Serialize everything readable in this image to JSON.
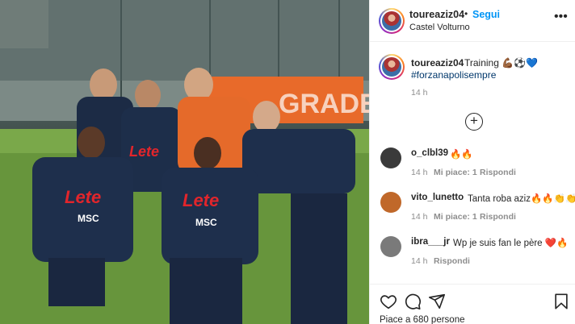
{
  "post": {
    "username": "toureaziz04",
    "separator": "•",
    "follow_label": "Segui",
    "location": "Castel Volturno",
    "more_label": "•••"
  },
  "caption": {
    "username": "toureaziz04",
    "text": "Training 💪🏾⚽️💙",
    "hashtag": "#forzanapolisempre",
    "time": "14 h"
  },
  "load_more_label": "+",
  "photo": {
    "banner_text": "GRADE",
    "shirt_sponsor": "Lete",
    "shirt_sponsor_2": "MSC"
  },
  "comments": [
    {
      "username": "o_clbl39",
      "text": "🔥🔥",
      "time": "14 h",
      "likes": "Mi piace: 1",
      "reply": "Rispondi",
      "avatar_color": "#3a3a3a"
    },
    {
      "username": "vito_lunetto",
      "text": "Tanta roba aziz🔥🔥👏👏👏",
      "time": "14 h",
      "likes": "Mi piace: 1",
      "reply": "Rispondi",
      "avatar_color": "#c0682a"
    },
    {
      "username": "ibra___jr",
      "text": "Wp je suis fan le père ❤️🔥",
      "time": "14 h",
      "likes": "",
      "reply": "Rispondi",
      "avatar_color": "#7a7a7a"
    }
  ],
  "actions": {
    "like_icon": "heart-icon",
    "comment_icon": "comment-icon",
    "share_icon": "share-icon",
    "save_icon": "bookmark-icon"
  },
  "likes_text": "Piace a 680 persone",
  "colors": {
    "link_blue": "#0095f6",
    "hashtag_blue": "#00376b",
    "secondary": "#8e8e8e"
  }
}
